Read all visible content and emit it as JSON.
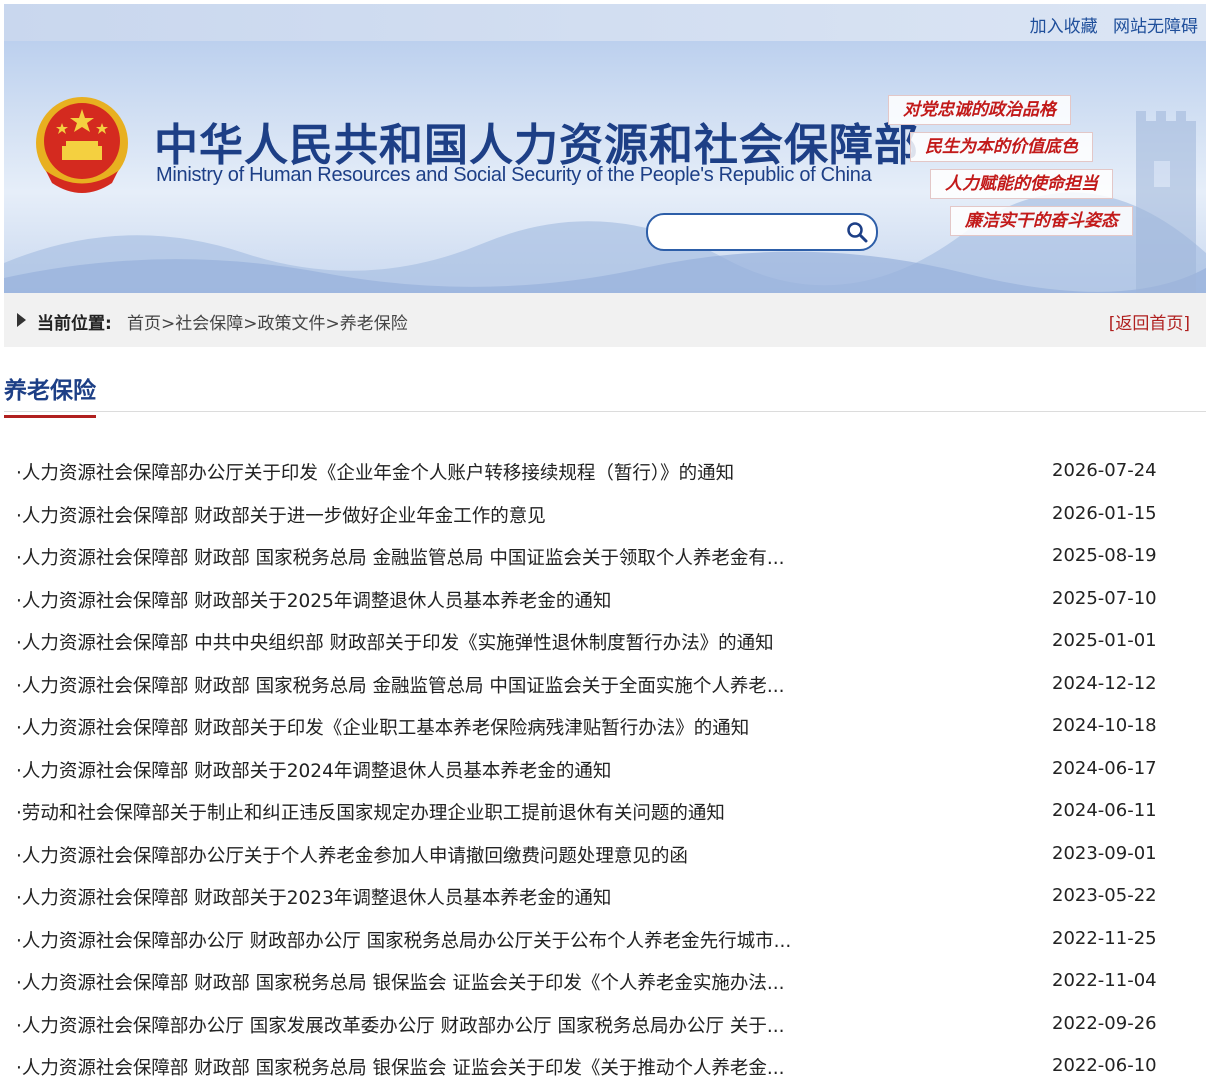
{
  "topbar": {
    "favorite": "加入收藏",
    "accessible": "网站无障碍"
  },
  "header": {
    "title": "中华人民共和国人力资源和社会保障部",
    "subtitle": "Ministry of Human Resources and Social Security of the People's Republic of China",
    "search_placeholder": "",
    "slogans": [
      "对党忠诚的政治品格",
      "民生为本的价值底色",
      "人力赋能的使命担当",
      "廉洁实干的奋斗姿态"
    ]
  },
  "breadcrumb": {
    "label": "当前位置:",
    "items": [
      "首页",
      "社会保障",
      "政策文件",
      "养老保险"
    ],
    "separator": ">",
    "back": "[返回首页]"
  },
  "section": {
    "title": "养老保险"
  },
  "articles": [
    {
      "title": "·人力资源社会保障部办公厅关于印发《企业年金个人账户转移接续规程（暂行）》的通知",
      "date": "2026-07-24"
    },
    {
      "title": "·人力资源社会保障部 财政部关于进一步做好企业年金工作的意见",
      "date": "2026-01-15"
    },
    {
      "title": "·人力资源社会保障部 财政部 国家税务总局 金融监管总局 中国证监会关于领取个人养老金有...",
      "date": "2025-08-19"
    },
    {
      "title": "·人力资源社会保障部 财政部关于2025年调整退休人员基本养老金的通知",
      "date": "2025-07-10"
    },
    {
      "title": "·人力资源社会保障部 中共中央组织部 财政部关于印发《实施弹性退休制度暂行办法》的通知",
      "date": "2025-01-01"
    },
    {
      "title": "·人力资源社会保障部 财政部 国家税务总局 金融监管总局 中国证监会关于全面实施个人养老...",
      "date": "2024-12-12"
    },
    {
      "title": "·人力资源社会保障部 财政部关于印发《企业职工基本养老保险病残津贴暂行办法》的通知",
      "date": "2024-10-18"
    },
    {
      "title": "·人力资源社会保障部 财政部关于2024年调整退休人员基本养老金的通知",
      "date": "2024-06-17"
    },
    {
      "title": "·劳动和社会保障部关于制止和纠正违反国家规定办理企业职工提前退休有关问题的通知",
      "date": "2024-06-11"
    },
    {
      "title": "·人力资源社会保障部办公厅关于个人养老金参加人申请撤回缴费问题处理意见的函",
      "date": "2023-09-01"
    },
    {
      "title": "·人力资源社会保障部 财政部关于2023年调整退休人员基本养老金的通知",
      "date": "2023-05-22"
    },
    {
      "title": "·人力资源社会保障部办公厅 财政部办公厅 国家税务总局办公厅关于公布个人养老金先行城市...",
      "date": "2022-11-25"
    },
    {
      "title": "·人力资源社会保障部 财政部 国家税务总局 银保监会 证监会关于印发《个人养老金实施办法...",
      "date": "2022-11-04"
    },
    {
      "title": "·人力资源社会保障部办公厅 国家发展改革委办公厅 财政部办公厅 国家税务总局办公厅 关于...",
      "date": "2022-09-26"
    },
    {
      "title": "·人力资源社会保障部 财政部 国家税务总局 银保监会 证监会关于印发《关于推动个人养老金...",
      "date": "2022-06-10"
    }
  ],
  "colors": {
    "primary": "#1d3f86",
    "accent": "#b0201f"
  }
}
